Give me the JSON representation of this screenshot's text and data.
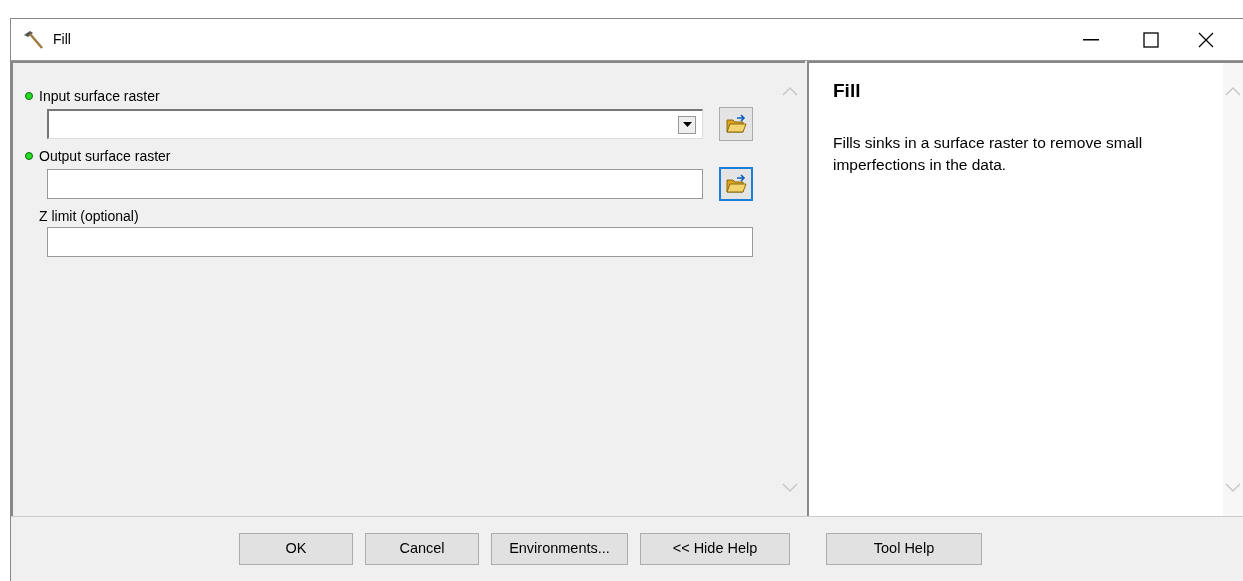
{
  "window": {
    "title": "Fill"
  },
  "parameters": [
    {
      "label": "Input surface raster",
      "required": true,
      "kind": "dropdown",
      "browse_focused": false
    },
    {
      "label": "Output surface raster",
      "required": true,
      "kind": "text",
      "browse_focused": true
    },
    {
      "label": "Z limit (optional)",
      "required": false,
      "kind": "text"
    }
  ],
  "help": {
    "title": "Fill",
    "text": "Fills sinks in a surface raster to remove small imperfections in the data."
  },
  "buttons": [
    {
      "label": "OK"
    },
    {
      "label": "Cancel"
    },
    {
      "label": "Environments..."
    },
    {
      "label": "<< Hide Help"
    },
    {
      "label": "Tool Help"
    }
  ]
}
